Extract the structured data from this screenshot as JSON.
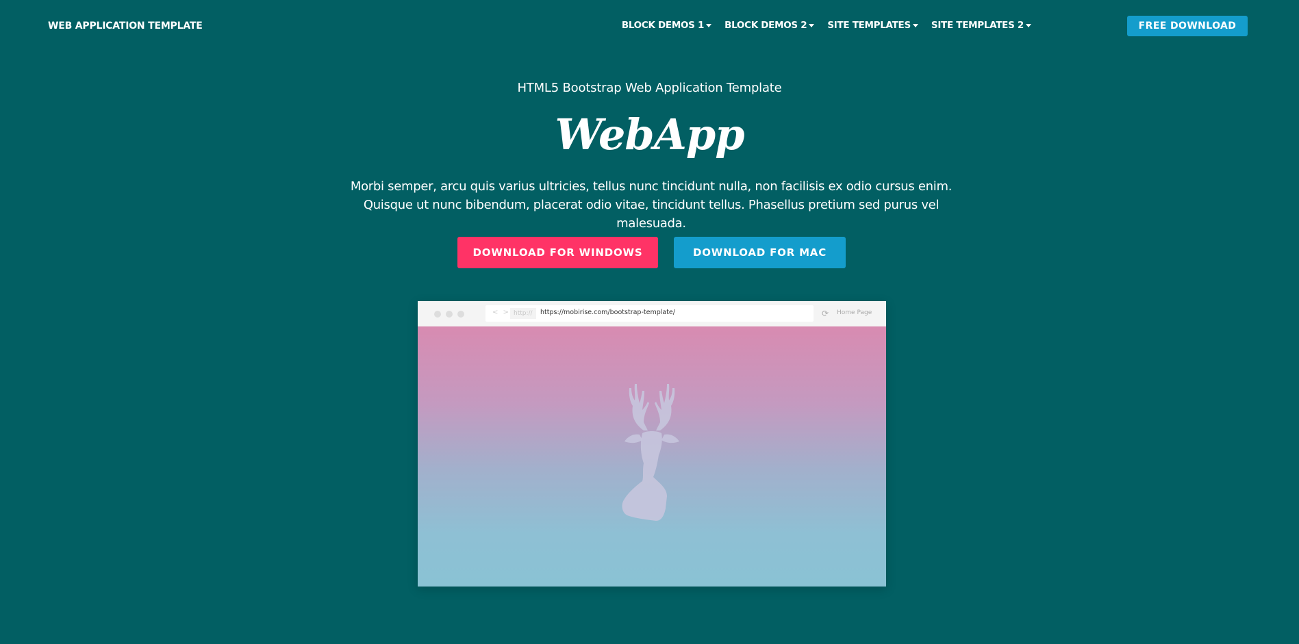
{
  "navbar": {
    "brand": "WEB APPLICATION TEMPLATE",
    "items": [
      {
        "label": "BLOCK DEMOS 1"
      },
      {
        "label": "BLOCK DEMOS 2"
      },
      {
        "label": "SITE TEMPLATES"
      },
      {
        "label": "SITE TEMPLATES 2"
      }
    ],
    "cta_label": "FREE DOWNLOAD"
  },
  "hero": {
    "subtitle": "HTML5 Bootstrap Web Application Template",
    "title": "WebApp",
    "description": "Morbi semper, arcu quis varius ultricies, tellus nunc tincidunt nulla, non facilisis ex odio cursus enim. Quisque ut nunc bibendum, placerat odio vitae, tincidunt tellus. Phasellus pretium sed purus vel malesuada.",
    "buttons": {
      "windows_label": "DOWNLOAD FOR WINDOWS",
      "mac_label": "DOWNLOAD FOR MAC"
    }
  },
  "browser_mockup": {
    "protocol": "http://",
    "url": "https://mobirise.com/bootstrap-template/",
    "home_link": "Home Page",
    "image": "deer-head-silhouette"
  },
  "colors": {
    "background": "#025f63",
    "accent_blue": "#149dcc",
    "accent_pink": "#ff3366"
  }
}
